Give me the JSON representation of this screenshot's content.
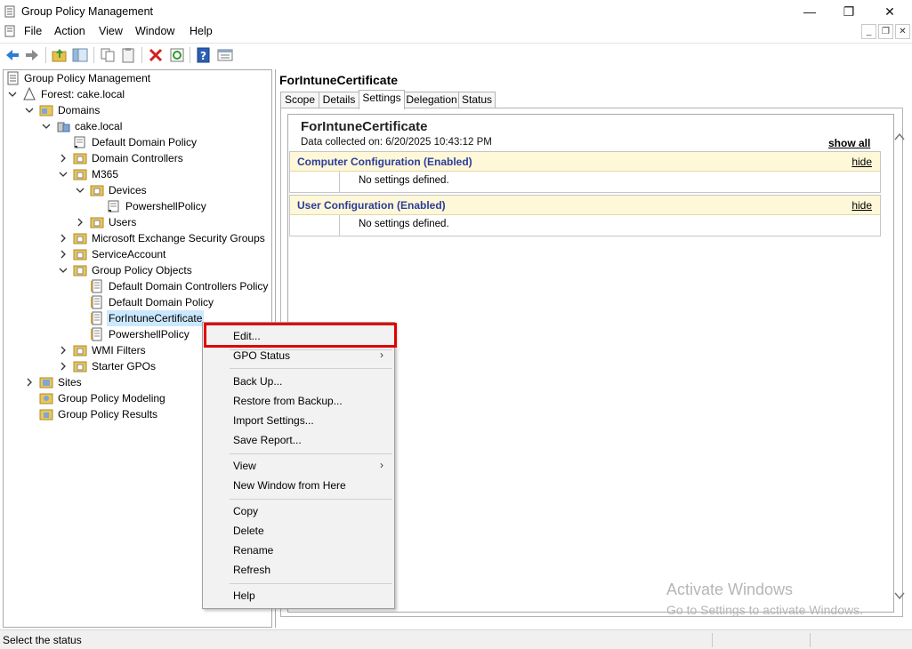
{
  "window": {
    "title": "Group Policy Management",
    "minimize": "—",
    "maximize": "❐",
    "close": "✕"
  },
  "menubar": {
    "items": [
      "File",
      "Action",
      "View",
      "Window",
      "Help"
    ],
    "mdi_minimize": "_",
    "mdi_restore": "❐",
    "mdi_close": "✕"
  },
  "toolbar": {
    "buttons": [
      "back-icon",
      "forward-icon",
      "up-folder-icon",
      "show-hide-tree-icon",
      "copy-icon",
      "paste-icon",
      "delete-icon",
      "refresh-icon",
      "help-icon",
      "properties-icon"
    ]
  },
  "tree": {
    "root": "Group Policy Management",
    "forest": "Forest: cake.local",
    "domains": "Domains",
    "domain": "cake.local",
    "default_domain_policy": "Default Domain Policy",
    "domain_controllers": "Domain Controllers",
    "m365": "M365",
    "devices": "Devices",
    "powershell_policy_link": "PowershellPolicy",
    "users": "Users",
    "exchange_groups": "Microsoft Exchange Security Groups",
    "service_account": "ServiceAccount",
    "gpo_container": "Group Policy Objects",
    "gpo_ddcp": "Default Domain Controllers Policy",
    "gpo_ddp": "Default Domain Policy",
    "gpo_intune": "ForIntuneCertificate",
    "gpo_powershell": "PowershellPolicy",
    "wmi_filters": "WMI Filters",
    "starter_gpos": "Starter GPOs",
    "sites": "Sites",
    "modeling": "Group Policy Modeling",
    "results": "Group Policy Results"
  },
  "details": {
    "title": "ForIntuneCertificate",
    "tabs": [
      "Scope",
      "Details",
      "Settings",
      "Delegation",
      "Status"
    ],
    "active_tab": "Settings",
    "report_title": "ForIntuneCertificate",
    "collected": "Data collected on: 6/20/2025 10:43:12 PM",
    "show_all": "show all",
    "sections": [
      {
        "title": "Computer Configuration (Enabled)",
        "hide": "hide",
        "body": "No settings defined."
      },
      {
        "title": "User Configuration (Enabled)",
        "hide": "hide",
        "body": "No settings defined."
      }
    ]
  },
  "context_menu": {
    "edit": "Edit...",
    "gpo_status": "GPO Status",
    "back_up": "Back Up...",
    "restore": "Restore from Backup...",
    "import": "Import Settings...",
    "save_report": "Save Report...",
    "view": "View",
    "new_window": "New Window from Here",
    "copy": "Copy",
    "delete": "Delete",
    "rename": "Rename",
    "refresh": "Refresh",
    "help": "Help",
    "submenu_arrow": "›"
  },
  "watermark": {
    "line1": "Activate Windows",
    "line2": "Go to Settings to activate Windows."
  },
  "status": {
    "text": "Select the status"
  },
  "colors": {
    "selection": "#cce8ff",
    "section_header_bg": "#fef8d8",
    "section_title": "#2c3c9c",
    "highlight_box": "#e00000"
  }
}
